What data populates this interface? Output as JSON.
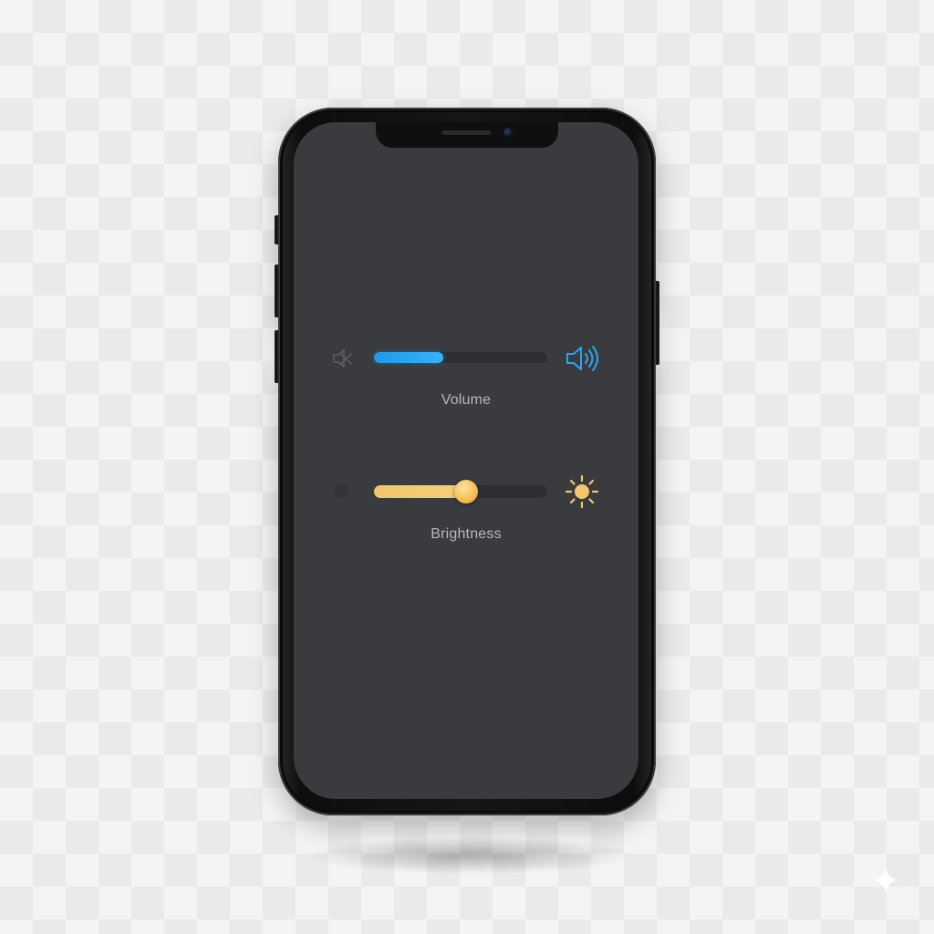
{
  "controls": {
    "volume": {
      "label": "Volume",
      "level": 0.4,
      "min_icon": "speaker-muted-icon",
      "max_icon": "speaker-loud-icon",
      "accent_color": "#2aa5f5"
    },
    "brightness": {
      "label": "Brightness",
      "level": 0.53,
      "min_icon": "brightness-low-icon",
      "max_icon": "sun-icon",
      "accent_color": "#f3c86c"
    }
  },
  "colors": {
    "screen_background": "#3a3b3e",
    "label_text": "#b6b8bd",
    "track": "#2e2f32"
  }
}
